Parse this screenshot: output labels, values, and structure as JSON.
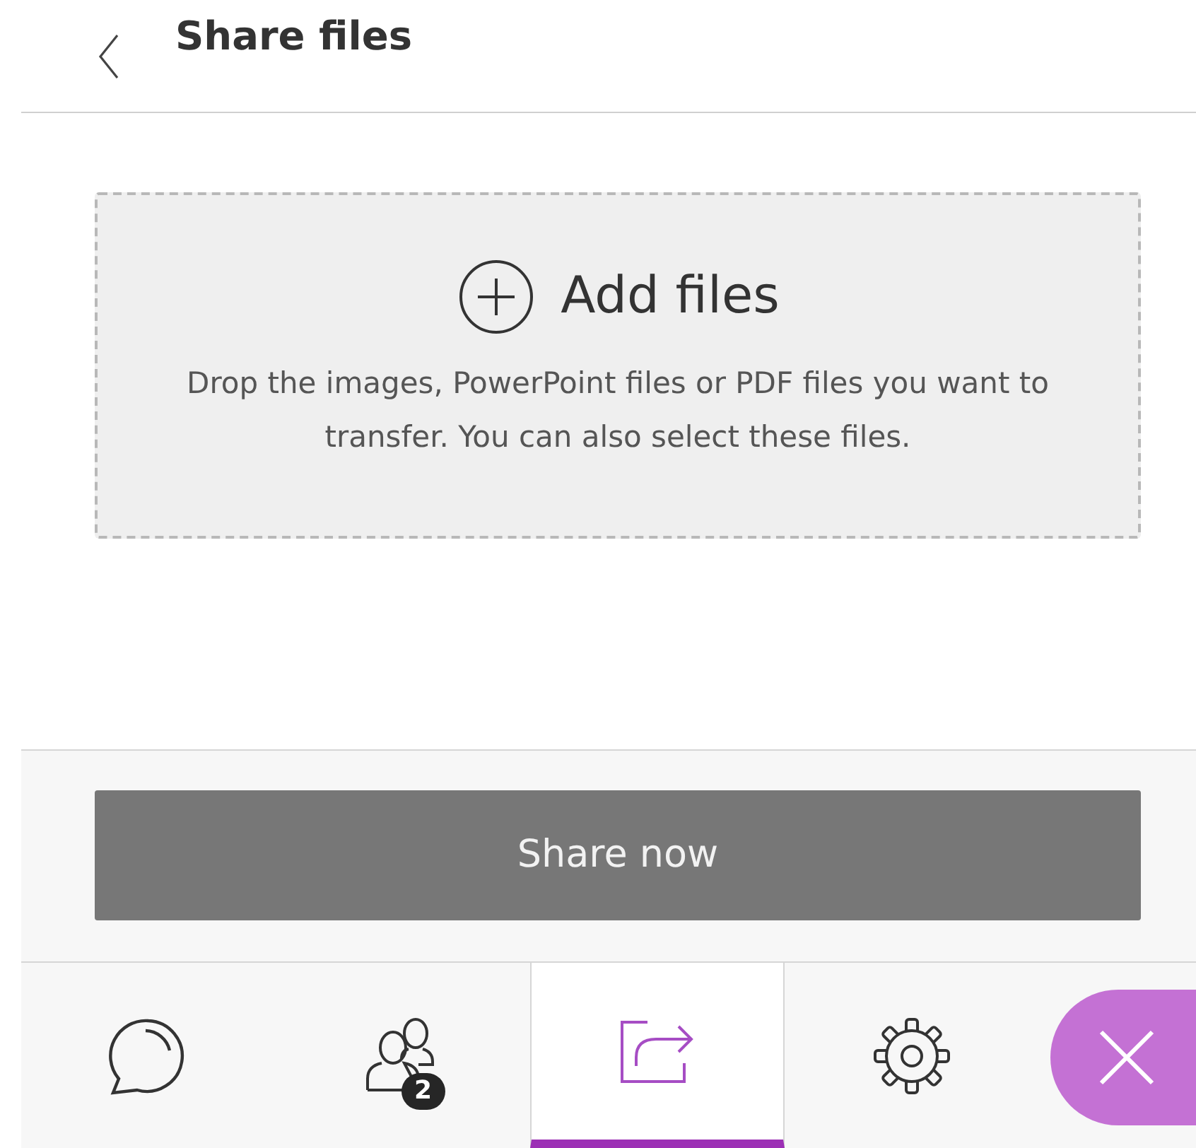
{
  "header": {
    "title": "Share files"
  },
  "drop_zone": {
    "title": "Add files",
    "hint": "Drop the images, PowerPoint files or PDF files you want to transfer. You can also select these files."
  },
  "share_button": {
    "label": "Share now",
    "disabled": true
  },
  "tabs": [
    {
      "kind": "chat",
      "selected": false
    },
    {
      "kind": "people",
      "badge": "2",
      "selected": false
    },
    {
      "kind": "share",
      "selected": true
    },
    {
      "kind": "settings",
      "selected": false
    }
  ]
}
